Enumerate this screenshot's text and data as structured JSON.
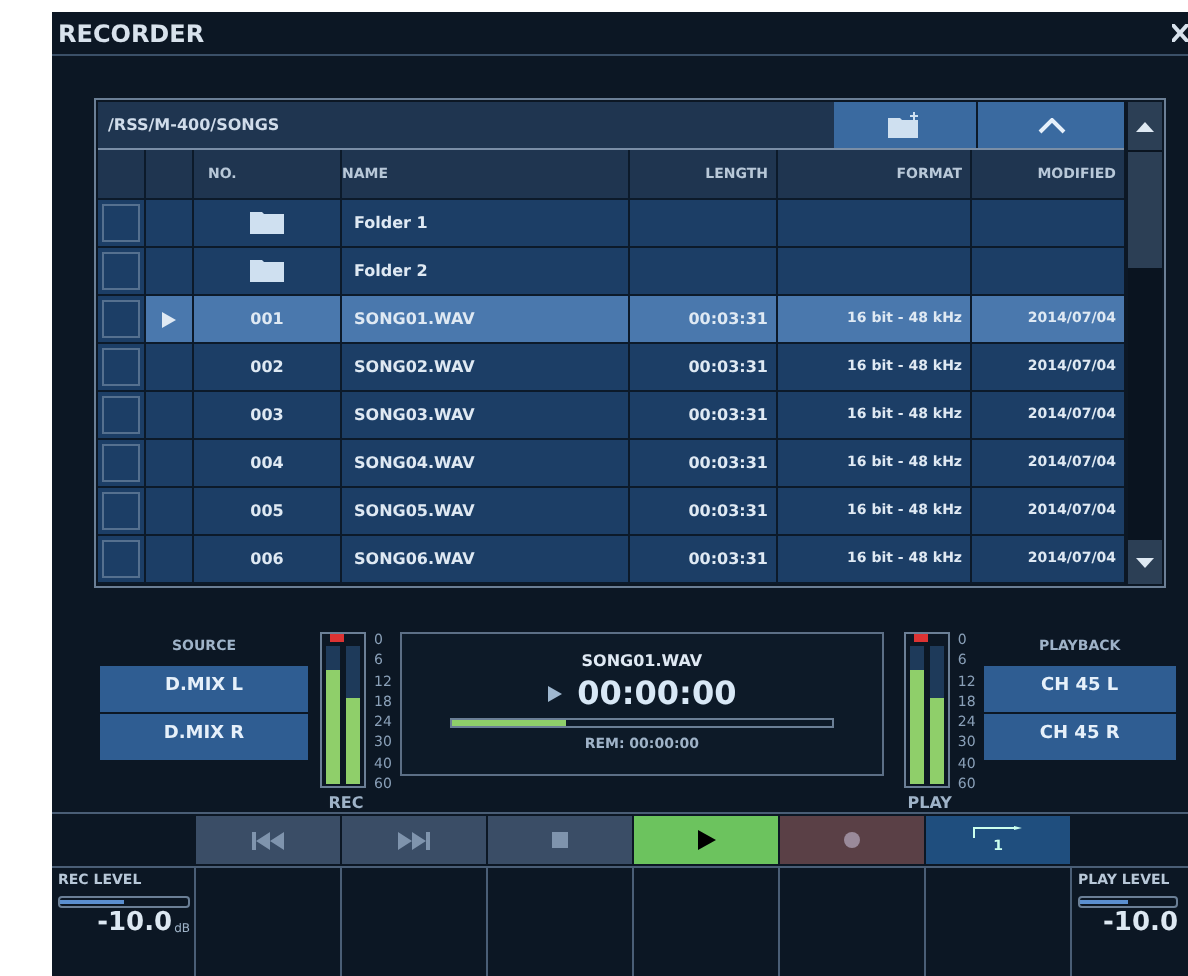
{
  "window": {
    "title": "RECORDER"
  },
  "browser": {
    "path": "/RSS/M-400/SONGS",
    "columns": [
      {
        "label": "NO."
      },
      {
        "label": "NAME"
      },
      {
        "label": "LENGTH"
      },
      {
        "label": "FORMAT"
      },
      {
        "label": "MODIFIED"
      }
    ],
    "rows": [
      {
        "kind": "folder",
        "checked": false,
        "selected": false,
        "name": "Folder 1"
      },
      {
        "kind": "folder",
        "checked": false,
        "selected": false,
        "name": "Folder 2"
      },
      {
        "kind": "file",
        "checked": false,
        "selected": true,
        "no": "001",
        "name": "SONG01.WAV",
        "length": "00:03:31",
        "format": "16 bit - 48 kHz",
        "modified": "2014/07/04"
      },
      {
        "kind": "file",
        "checked": false,
        "selected": false,
        "no": "002",
        "name": "SONG02.WAV",
        "length": "00:03:31",
        "format": "16 bit - 48 kHz",
        "modified": "2014/07/04"
      },
      {
        "kind": "file",
        "checked": false,
        "selected": false,
        "no": "003",
        "name": "SONG03.WAV",
        "length": "00:03:31",
        "format": "16 bit - 48 kHz",
        "modified": "2014/07/04"
      },
      {
        "kind": "file",
        "checked": false,
        "selected": false,
        "no": "004",
        "name": "SONG04.WAV",
        "length": "00:03:31",
        "format": "16 bit - 48 kHz",
        "modified": "2014/07/04"
      },
      {
        "kind": "file",
        "checked": false,
        "selected": false,
        "no": "005",
        "name": "SONG05.WAV",
        "length": "00:03:31",
        "format": "16 bit - 48 kHz",
        "modified": "2014/07/04"
      },
      {
        "kind": "file",
        "checked": false,
        "selected": false,
        "no": "006",
        "name": "SONG06.WAV",
        "length": "00:03:31",
        "format": "16 bit - 48 kHz",
        "modified": "2014/07/04"
      }
    ]
  },
  "source": {
    "label": "SOURCE",
    "buttons": [
      "D.MIX L",
      "D.MIX R"
    ]
  },
  "rec_meter": {
    "label": "REC",
    "channels": [
      {
        "level": 0.82
      },
      {
        "level": 0.62
      }
    ],
    "scale": [
      "0",
      "6",
      "12",
      "18",
      "24",
      "30",
      "40",
      "60"
    ]
  },
  "display": {
    "file": "SONG01.WAV",
    "time": "00:00:00",
    "remaining": "REM: 00:00:00",
    "progress": {
      "level": 0.3
    }
  },
  "play_meter": {
    "label": "PLAY",
    "channels": [
      {
        "level": 0.82
      },
      {
        "level": 0.62
      }
    ],
    "scale": [
      "0",
      "6",
      "12",
      "18",
      "24",
      "30",
      "40",
      "60"
    ]
  },
  "playback": {
    "label": "PLAYBACK",
    "buttons": [
      "CH 45 L",
      "CH 45 R"
    ]
  },
  "transport": [
    {
      "kind": "previous",
      "selected": false
    },
    {
      "kind": "next",
      "selected": false
    },
    {
      "kind": "stop",
      "selected": false
    },
    {
      "kind": "play",
      "selected": true
    },
    {
      "kind": "record",
      "selected": false
    },
    {
      "kind": "repeat",
      "selected": false,
      "label": "1"
    }
  ],
  "rec_level": {
    "label": "REC LEVEL",
    "level": 0.5,
    "value": "-10.0",
    "unit": "dB"
  },
  "play_level": {
    "label": "PLAY LEVEL",
    "level": 0.5,
    "value": "-10.0"
  }
}
